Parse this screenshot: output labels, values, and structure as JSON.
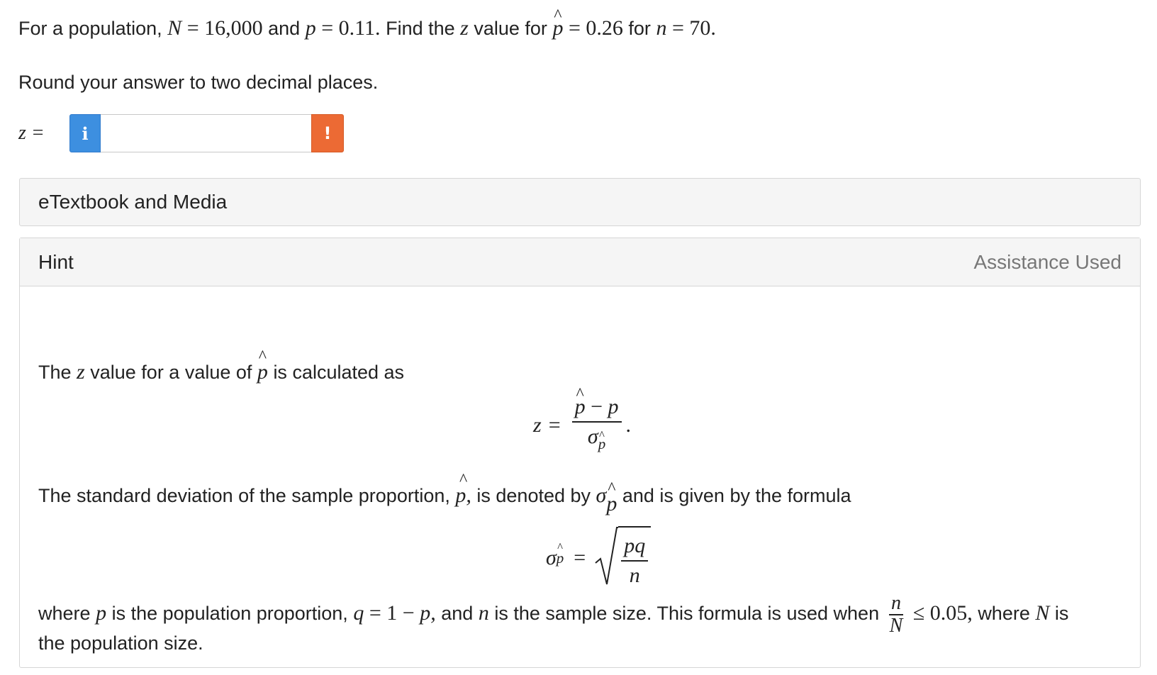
{
  "question": {
    "t1": "For a population,",
    "N": "N",
    "eq": "=",
    "N_val": "16,000",
    "and": "and",
    "p": "p",
    "p_val": "0.11.",
    "find": "Find the",
    "z": "z",
    "value_for": "value for",
    "phat": "p",
    "phat_val": "0.26",
    "for": "for",
    "n": "n",
    "n_val": "70."
  },
  "round_text": "Round your answer to two decimal places.",
  "answer": {
    "label": "z =",
    "info_icon_glyph": "i",
    "warn_icon_glyph": "!",
    "value": "",
    "placeholder": ""
  },
  "etextbook": {
    "label": "eTextbook and Media"
  },
  "hint": {
    "title": "Hint",
    "assistance": "Assistance Used",
    "line1_a": "The",
    "line1_z": "z",
    "line1_b": "value for a value of",
    "line1_phat": "p",
    "line1_c": "is calculated as",
    "f1_z": "z",
    "f1_eq": "=",
    "f1_num_phat": "p",
    "f1_minus": "−",
    "f1_num_p": "p",
    "f1_den_sigma": "σ",
    "f1_den_sub": "p",
    "f1_period": ".",
    "line2_a": "The standard deviation of the sample proportion,",
    "line2_phat": "p,",
    "line2_b": "is denoted by",
    "line2_sigma": "σ",
    "line2_sub": "p",
    "line2_c": "and is given by the formula",
    "f2_sigma": "σ",
    "f2_sub": "p",
    "f2_eq": "=",
    "f2_num": "pq",
    "f2_den": "n",
    "line3_a": "where",
    "line3_p": "p",
    "line3_b": "is the population proportion,",
    "line3_q": "q",
    "line3_eq": "=",
    "line3_one": "1",
    "line3_minus": "−",
    "line3_p2": "p,",
    "line3_c": "and",
    "line3_n": "n",
    "line3_d": "is the sample size. This formula is used when",
    "line3_frac_num": "n",
    "line3_frac_den": "N",
    "line3_le": "≤",
    "line3_val": "0.05,",
    "line3_e": "where",
    "line3_N": "N",
    "line3_f": "is",
    "line4": "the population size."
  }
}
